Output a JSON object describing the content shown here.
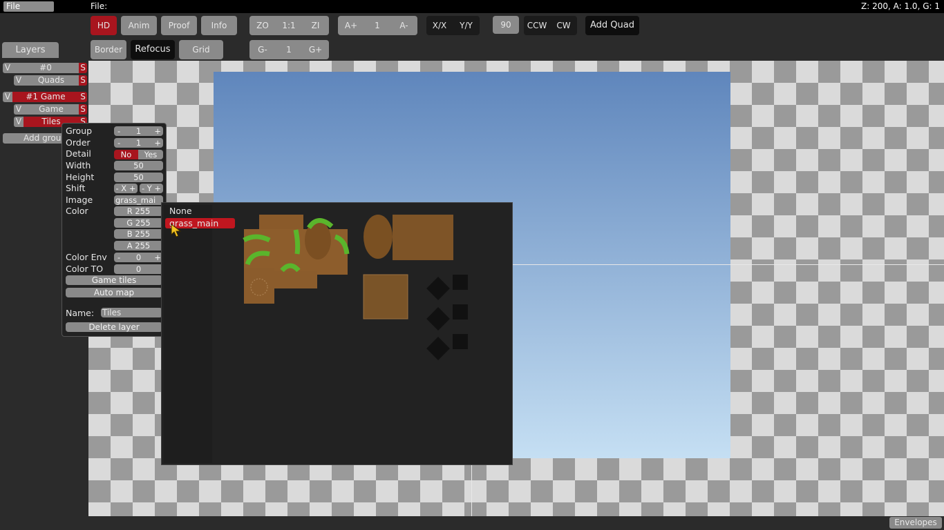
{
  "menu": {
    "file_button": "File",
    "file_label": "File:",
    "status": "Z: 200, A: 1.0, G: 1"
  },
  "toolbar": {
    "hd": "HD",
    "anim": "Anim",
    "proof": "Proof",
    "info": "Info",
    "zo": "ZO",
    "one_to_one": "1:1",
    "zi": "ZI",
    "a_plus": "A+",
    "a_value": "1",
    "a_minus": "A-",
    "flip_x": "X/X",
    "flip_y": "Y/Y",
    "rotate_value": "90",
    "ccw": "CCW",
    "cw": "CW",
    "add_quad": "Add Quad",
    "border": "Border",
    "refocus": "Refocus",
    "grid": "Grid",
    "g_minus": "G-",
    "g_value": "1",
    "g_plus": "G+"
  },
  "sidebar": {
    "tab": "Layers",
    "rows": [
      {
        "v": "V",
        "name": "#0",
        "s": "S"
      },
      {
        "v": "V",
        "name": "Quads",
        "s": "S"
      },
      {
        "v": "V",
        "name": "#1 Game",
        "s": "S"
      },
      {
        "v": "V",
        "name": "Game",
        "s": "S"
      },
      {
        "v": "V",
        "name": "Tiles",
        "s": "S"
      }
    ],
    "add_group": "Add group"
  },
  "properties": {
    "group_label": "Group",
    "group_minus": "-",
    "group_value": "1",
    "group_plus": "+",
    "order_label": "Order",
    "order_minus": "-",
    "order_value": "1",
    "order_plus": "+",
    "detail_label": "Detail",
    "detail_no": "No",
    "detail_yes": "Yes",
    "width_label": "Width",
    "width_value": "50",
    "height_label": "Height",
    "height_value": "50",
    "shift_label": "Shift",
    "shift_x": "- X +",
    "shift_y": "- Y +",
    "image_label": "Image",
    "image_value": "grass_mai",
    "color_label": "Color",
    "r": "R 255",
    "g": "G 255",
    "b": "B 255",
    "a": "A 255",
    "color_env_label": "Color Env",
    "color_env_minus": "-",
    "color_env_value": "0",
    "color_env_plus": "+",
    "color_to_label": "Color TO",
    "color_to_value": "0",
    "game_tiles": "Game tiles",
    "auto_map": "Auto map",
    "name_label": "Name:",
    "name_value": "Tiles",
    "delete_layer": "Delete layer"
  },
  "image_picker": {
    "options": [
      "None",
      "grass_main"
    ],
    "selected": "grass_main"
  },
  "footer": {
    "envelopes": "Envelopes"
  },
  "colors": {
    "accent_red": "#a8151e",
    "button_grey": "#8a8a8a",
    "sky_top": "#5f86bc",
    "sky_bottom": "#c5dff3"
  }
}
